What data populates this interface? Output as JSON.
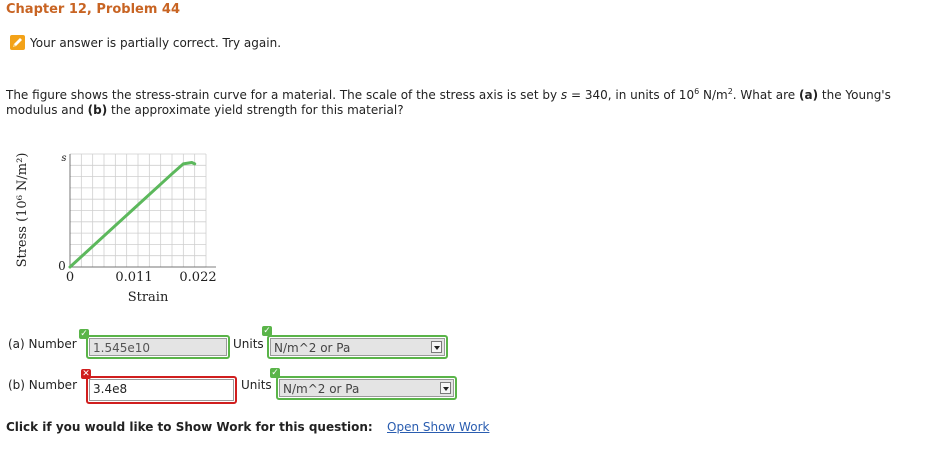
{
  "problem": {
    "title": "Chapter 12, Problem 44"
  },
  "status": {
    "message": "Your answer is partially correct.  Try again.",
    "icon": "pencil-icon",
    "color": "#f3a218"
  },
  "question": {
    "part1": "The figure shows the stress-strain curve for a material. The scale of the stress axis is set by ",
    "var_s": "s",
    "part2": " = 340, in units of 10",
    "exp": "6",
    "part3": " N/m",
    "exp2": "2",
    "part4": ". What are ",
    "a_tag": "(a)",
    "part5": " the Young's modulus and ",
    "b_tag": "(b)",
    "part6": " the approximate yield strength for this material?"
  },
  "figure": {
    "ylabel": "Stress (10⁶ N/m²)",
    "xlabel": "Strain",
    "y_ticks": [
      "0",
      "s"
    ],
    "x_ticks": [
      "0",
      "0.011",
      "0.022"
    ]
  },
  "chart_data": {
    "type": "line",
    "xlabel": "Strain",
    "ylabel": "Stress (10⁶ N/m²)",
    "x_ticks": [
      "0",
      "0.011",
      "0.022"
    ],
    "y_ticks": [
      "0",
      "s"
    ],
    "xlim": [
      0,
      0.024
    ],
    "ylim": [
      0,
      8
    ],
    "grid": true,
    "series": [
      {
        "color": "#5cb85c",
        "x": [
          0,
          0.018,
          0.02,
          0.0215,
          0.022
        ],
        "y": [
          0,
          6.6,
          7.3,
          7.4,
          7.3
        ]
      }
    ]
  },
  "answers": {
    "a": {
      "label": "(a) Number",
      "value": "1.545e10",
      "state": "correct",
      "units_label": "Units",
      "units_value": "N/m^2 or Pa",
      "units_state": "correct"
    },
    "b": {
      "label": "(b) Number",
      "value": "3.4e8",
      "state": "incorrect",
      "units_label": "Units",
      "units_value": "N/m^2 or Pa",
      "units_state": "correct"
    }
  },
  "colors": {
    "correct": "#5ab449",
    "incorrect": "#d01e1e",
    "title": "#c86423",
    "link": "#2a5db0"
  },
  "footer": {
    "prompt": "Click if you would like to Show Work for this question:",
    "link_text": "Open Show Work"
  }
}
